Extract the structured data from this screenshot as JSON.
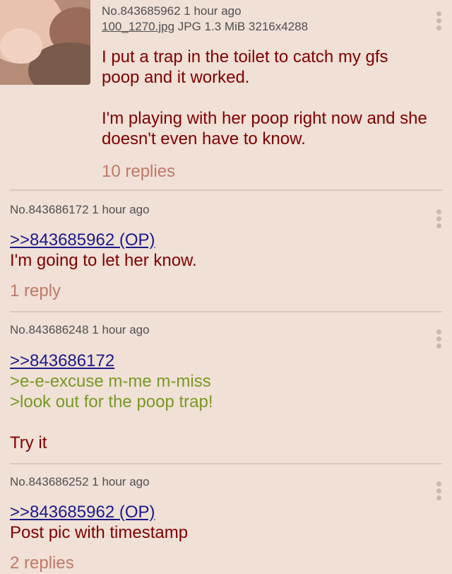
{
  "colors": {
    "background": "#f0e0d6",
    "text": "#800000",
    "meta": "#505050",
    "quotelink": "#1b1a8a",
    "greentext": "#789922",
    "replies": "#c07868",
    "divider": "#d9c7bd"
  },
  "posts": [
    {
      "meta": "No.843685962 1 hour ago",
      "file": {
        "name": "100_1270.jpg",
        "details": " JPG 1.3 MiB 3216x4288"
      },
      "thumbnail_icon": "image-thumbnail",
      "body": {
        "line1": "I put a trap in the toilet to catch my gfs",
        "line2": "poop and it worked.",
        "line3": "I'm playing with her poop right now and she",
        "line4": "doesn't even have to know."
      },
      "replies": "10 replies"
    },
    {
      "meta": "No.843686172 1 hour ago",
      "quotelink": ">>843685962 (OP)",
      "body": {
        "line1": "I'm going to let her know."
      },
      "replies": "1 reply"
    },
    {
      "meta": "No.843686248 1 hour ago",
      "quotelink": ">>843686172",
      "greentext": [
        ">e-e-excuse m-me m-miss",
        ">look out for the poop trap!"
      ],
      "body": {
        "line1": "Try it"
      }
    },
    {
      "meta": "No.843686252 1 hour ago",
      "quotelink": ">>843685962 (OP)",
      "body": {
        "line1": "Post pic with timestamp"
      },
      "replies": "2 replies"
    }
  ]
}
